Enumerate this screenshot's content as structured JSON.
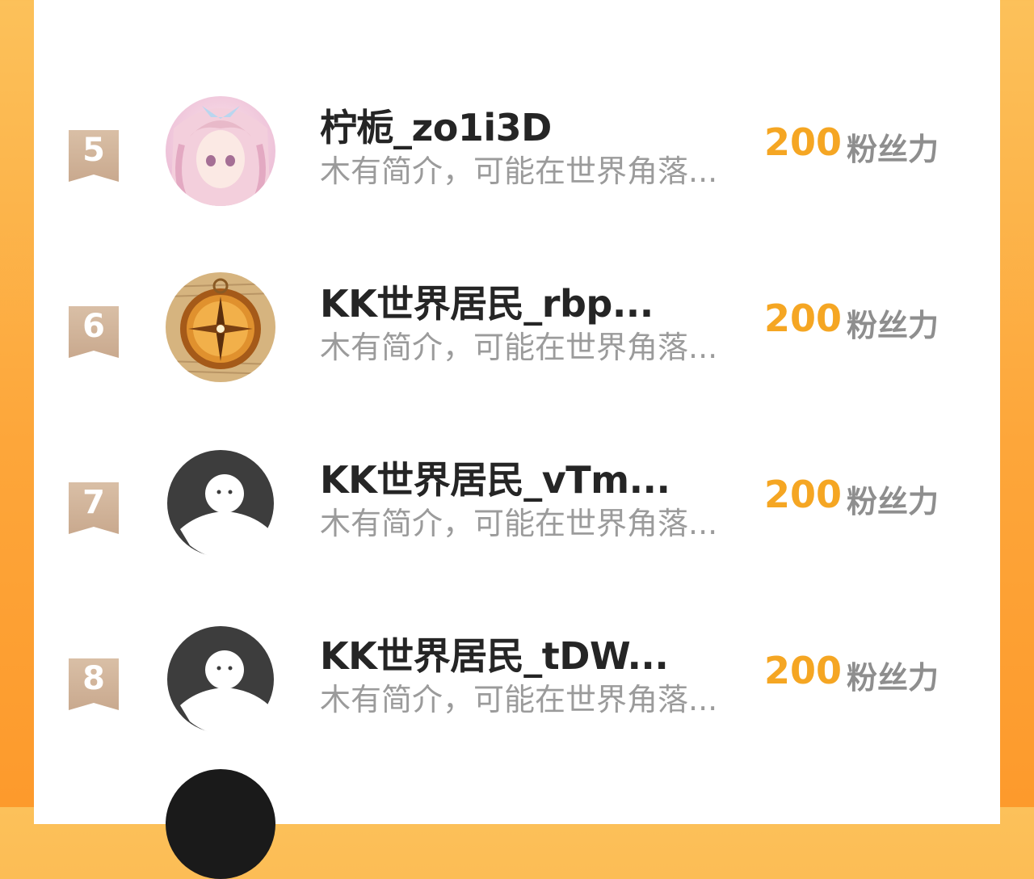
{
  "leaderboard": {
    "rows": [
      {
        "rank": "5",
        "name": "柠栀_zo1i3D",
        "bio": "木有简介，可能在世界角落...",
        "score": "200",
        "unit": "粉丝力",
        "avatar_icon": "anime-girl-avatar"
      },
      {
        "rank": "6",
        "name": "KK世界居民_rbp...",
        "bio": "木有简介，可能在世界角落...",
        "score": "200",
        "unit": "粉丝力",
        "avatar_icon": "compass-avatar"
      },
      {
        "rank": "7",
        "name": "KK世界居民_vTm...",
        "bio": "木有简介，可能在世界角落...",
        "score": "200",
        "unit": "粉丝力",
        "avatar_icon": "default-avatar"
      },
      {
        "rank": "8",
        "name": "KK世界居民_tDW...",
        "bio": "木有简介，可能在世界角落...",
        "score": "200",
        "unit": "粉丝力",
        "avatar_icon": "default-avatar"
      }
    ],
    "colors": {
      "score": "#f5a623",
      "rank_badge": "#c9a98e",
      "background": "#fda63a"
    }
  }
}
